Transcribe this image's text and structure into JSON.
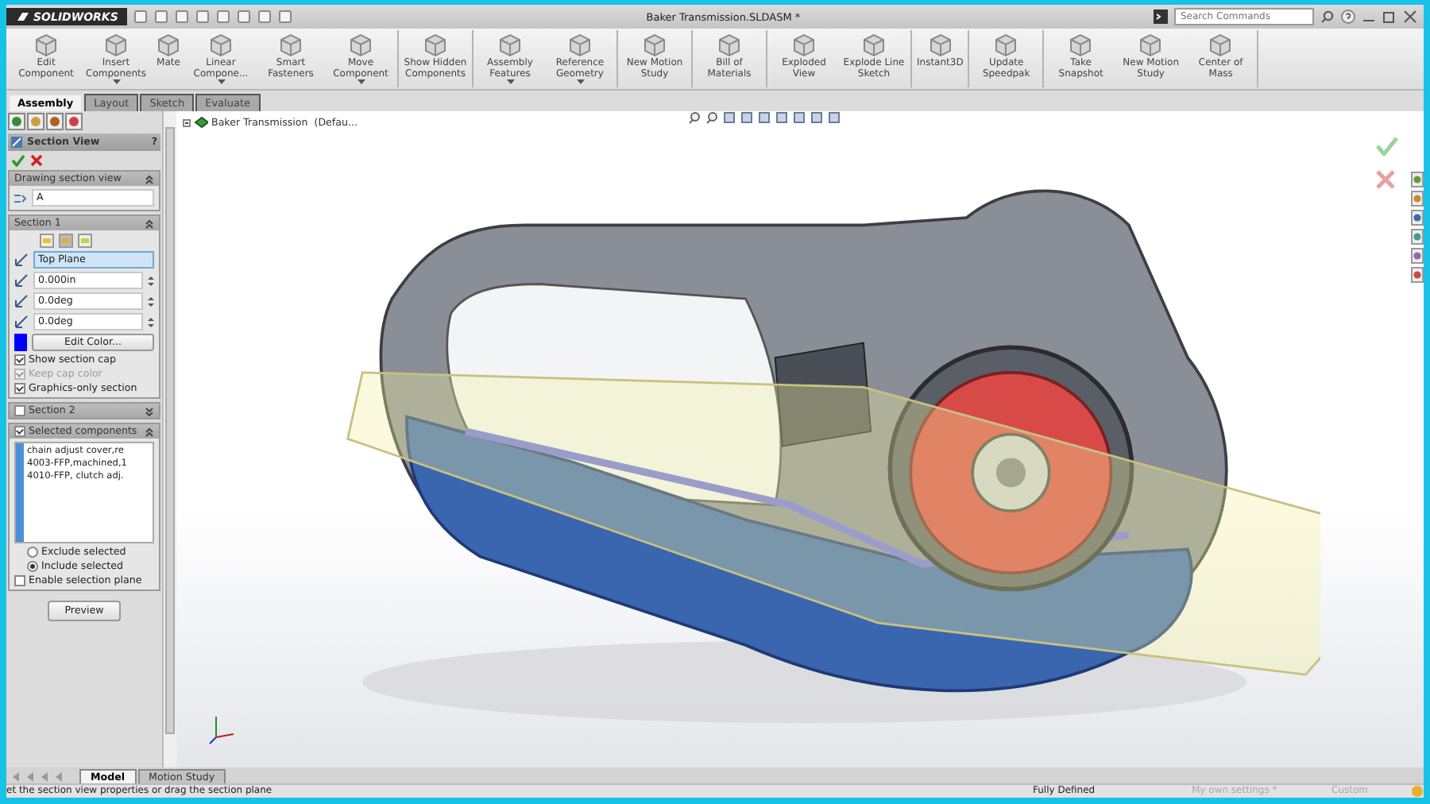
{
  "title_bar": {
    "logo": "SOLIDWORKS",
    "document_title": "Baker Transmission.SLDASM *",
    "search": {
      "placeholder": "Search Commands"
    }
  },
  "ribbon": {
    "groups": [
      [
        {
          "label": "Edit Component",
          "dropdown": false
        },
        {
          "label": "Insert Components",
          "dropdown": true
        },
        {
          "label": "Mate",
          "dropdown": false
        },
        {
          "label": "Linear Compone...",
          "dropdown": true
        },
        {
          "label": "Smart Fasteners",
          "dropdown": false
        },
        {
          "label": "Move Component",
          "dropdown": true
        }
      ],
      [
        {
          "label": "Show Hidden Components",
          "dropdown": false
        }
      ],
      [
        {
          "label": "Assembly Features",
          "dropdown": true
        },
        {
          "label": "Reference Geometry",
          "dropdown": true
        }
      ],
      [
        {
          "label": "New Motion Study",
          "dropdown": false
        }
      ],
      [
        {
          "label": "Bill of Materials",
          "dropdown": false
        }
      ],
      [
        {
          "label": "Exploded View",
          "dropdown": false
        },
        {
          "label": "Explode Line Sketch",
          "dropdown": false
        }
      ],
      [
        {
          "label": "Instant3D",
          "dropdown": false
        }
      ],
      [
        {
          "label": "Update Speedpak",
          "dropdown": false
        }
      ],
      [
        {
          "label": "Take Snapshot",
          "dropdown": false
        },
        {
          "label": "New Motion Study",
          "dropdown": false
        },
        {
          "label": "Center of Mass",
          "dropdown": false
        }
      ]
    ]
  },
  "ribbon_tabs": [
    {
      "label": "Assembly",
      "selected": true
    },
    {
      "label": "Layout",
      "selected": false
    },
    {
      "label": "Sketch",
      "selected": false
    },
    {
      "label": "Evaluate",
      "selected": false
    }
  ],
  "property_manager": {
    "title": "Section View",
    "help": "?",
    "drawing_section_view": {
      "heading": "Drawing section view",
      "value": "A"
    },
    "section_1": {
      "heading": "Section 1",
      "plane": "Top Plane",
      "offset": "0.000in",
      "angle_x": "0.0deg",
      "angle_y": "0.0deg",
      "edit_color_button": "Edit Color...",
      "options": [
        {
          "label": "Show section cap",
          "checked": true,
          "disabled": false
        },
        {
          "label": "Keep cap color",
          "checked": true,
          "disabled": true
        },
        {
          "label": "Graphics-only section",
          "checked": true,
          "disabled": false
        }
      ]
    },
    "section_2": {
      "heading": "Section 2",
      "checked": false,
      "expanded": false
    },
    "selected_components": {
      "heading": "Selected components",
      "checked": true,
      "items": [
        "chain adjust cover,re",
        "4003-FFP,machined,1",
        "4010-FFP, clutch adj."
      ],
      "modes": [
        {
          "label": "Exclude selected",
          "selected": false
        },
        {
          "label": "Include selected",
          "selected": true
        }
      ],
      "enable_plane": {
        "label": "Enable selection plane",
        "checked": false
      }
    },
    "preview_button": "Preview"
  },
  "viewport": {
    "tree_item": "Baker Transmission  (Defau..."
  },
  "bottom_tabs": [
    {
      "label": "Model",
      "selected": true
    },
    {
      "label": "Motion Study",
      "selected": false
    }
  ],
  "status_bar": {
    "message": "et the section view properties or drag the section plane",
    "state": "Fully Defined",
    "settings": "My own settings *",
    "units": "Custom"
  }
}
